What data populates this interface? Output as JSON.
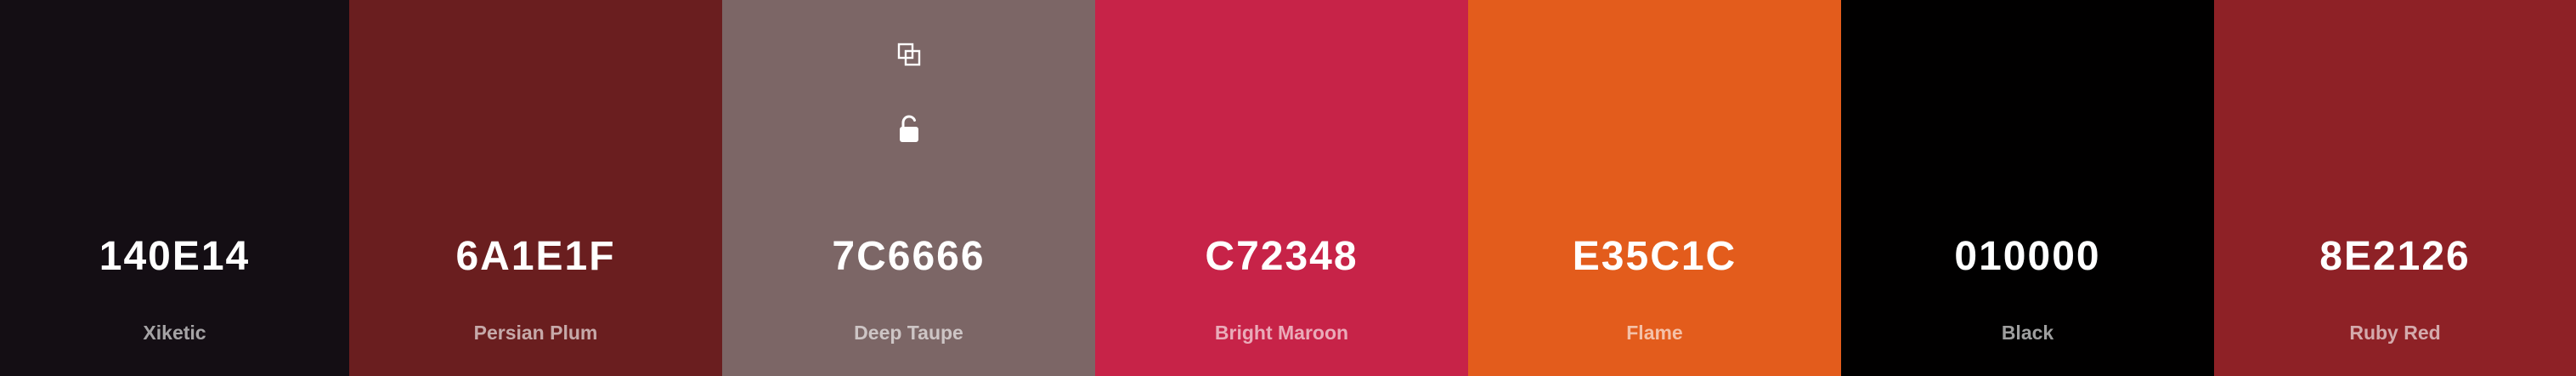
{
  "swatches": [
    {
      "hex": "140E14",
      "name": "Xiketic",
      "color": "#140E14"
    },
    {
      "hex": "6A1E1F",
      "name": "Persian Plum",
      "color": "#6A1E1F"
    },
    {
      "hex": "7C6666",
      "name": "Deep Taupe",
      "color": "#7C6666"
    },
    {
      "hex": "C72348",
      "name": "Bright Maroon",
      "color": "#C72348"
    },
    {
      "hex": "E35C1C",
      "name": "Flame",
      "color": "#E35C1C"
    },
    {
      "hex": "010000",
      "name": "Black",
      "color": "#010000"
    },
    {
      "hex": "8E2126",
      "name": "Ruby Red",
      "color": "#8E2126"
    }
  ],
  "hover_tools": {
    "swatch_index": 2,
    "icons": [
      "copy-icon",
      "unlock-icon"
    ]
  }
}
